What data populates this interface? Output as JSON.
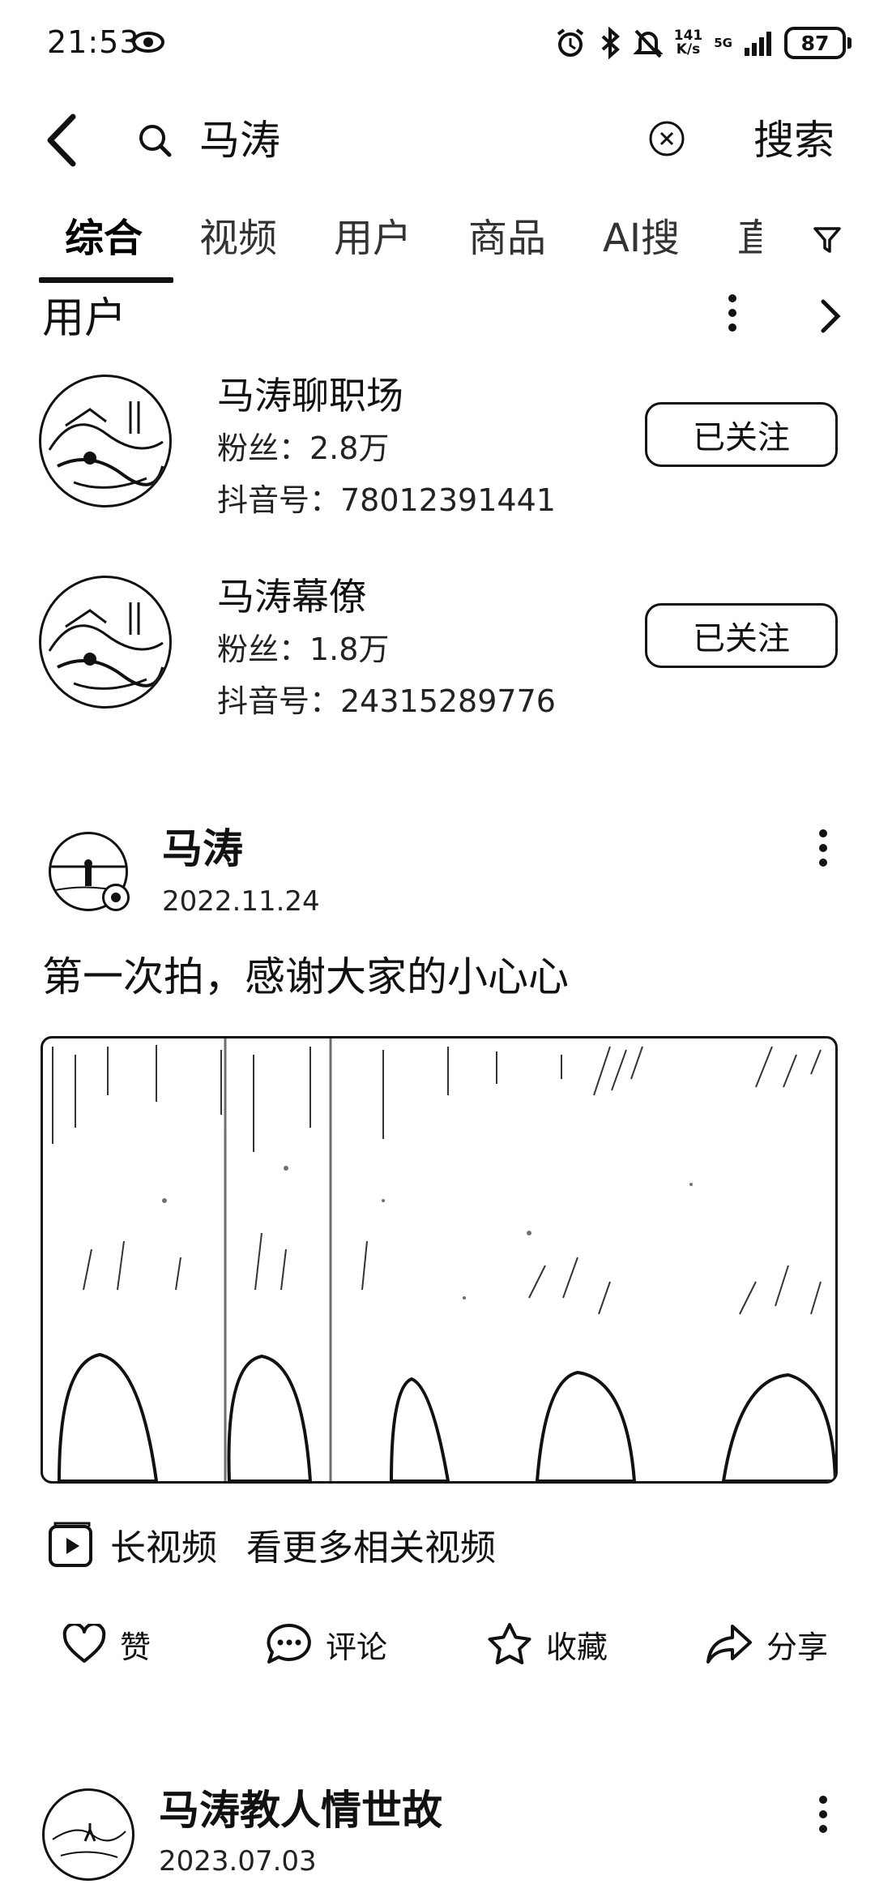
{
  "status_bar": {
    "time": "21:53",
    "net_speed_top": "141",
    "net_speed_bottom": "K/s",
    "network": "5G",
    "battery": "87"
  },
  "search": {
    "query": "马涛",
    "button_label": "搜索"
  },
  "tabs": [
    "综合",
    "视频",
    "用户",
    "商品",
    "AI搜",
    "直"
  ],
  "users_section": {
    "title": "用户",
    "users": [
      {
        "name": "马涛聊职场",
        "fans": "粉丝：2.8万",
        "douyin_id": "抖音号：78012391441",
        "follow_label": "已关注"
      },
      {
        "name": "马涛幕僚",
        "fans": "粉丝：1.8万",
        "douyin_id": "抖音号：24315289776",
        "follow_label": "已关注"
      }
    ]
  },
  "post": {
    "author": "马涛",
    "date": "2022.11.24",
    "text": "第一次拍，感谢大家的小心心",
    "long_video_tag": "长视频",
    "long_video_link": "看更多相关视频",
    "actions": {
      "like": "赞",
      "comment": "评论",
      "favorite": "收藏",
      "share": "分享"
    }
  },
  "post2": {
    "author": "马涛教人情世故",
    "date": "2023.07.03"
  },
  "colors": {
    "text": "#111111",
    "background": "#ffffff"
  }
}
